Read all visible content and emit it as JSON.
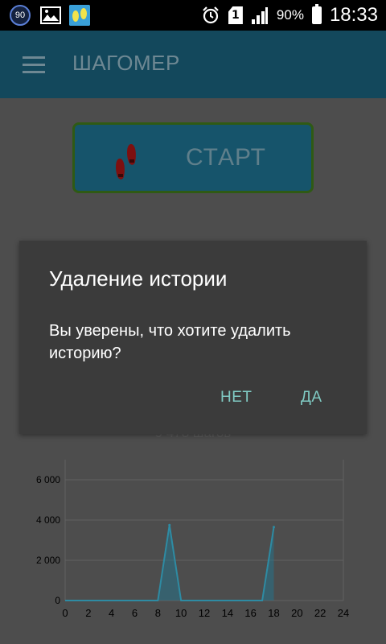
{
  "status_bar": {
    "badge": "90",
    "sim": "1",
    "battery": "90%",
    "time": "18:33",
    "icons": [
      "notification-90-icon",
      "gallery-icon",
      "footprints-icon",
      "alarm-icon",
      "sim-1-icon",
      "signal-icon",
      "battery-icon"
    ]
  },
  "app_bar": {
    "title": "ШАГОМЕР"
  },
  "start_button": {
    "label": "СТАРТ"
  },
  "chart_caption": "9 478 шагов",
  "chart_data": {
    "type": "area",
    "x": [
      0,
      1,
      2,
      3,
      4,
      5,
      6,
      7,
      8,
      9,
      10,
      11,
      12,
      13,
      14,
      15,
      16,
      17,
      18
    ],
    "series": [
      {
        "values": [
          0,
          0,
          0,
          0,
          0,
          0,
          0,
          0,
          0,
          3750,
          0,
          0,
          0,
          0,
          0,
          0,
          0,
          0,
          3650
        ]
      }
    ],
    "x_ticks": [
      "0",
      "2",
      "4",
      "6",
      "8",
      "10",
      "12",
      "14",
      "16",
      "18",
      "20",
      "22",
      "24"
    ],
    "y_ticks": [
      "0",
      "2 000",
      "4 000",
      "6 000"
    ],
    "xlim": [
      0,
      24
    ],
    "ylim": [
      0,
      7000
    ],
    "grid": true,
    "colors": {
      "line": "#2e8ba3",
      "fill": "#27728a",
      "grid": "#616161",
      "text": "#000000"
    }
  },
  "dialog": {
    "title": "Удаление истории",
    "message": "Вы уверены, что хотите удалить историю?",
    "negative": "НЕТ",
    "positive": "ДА"
  }
}
